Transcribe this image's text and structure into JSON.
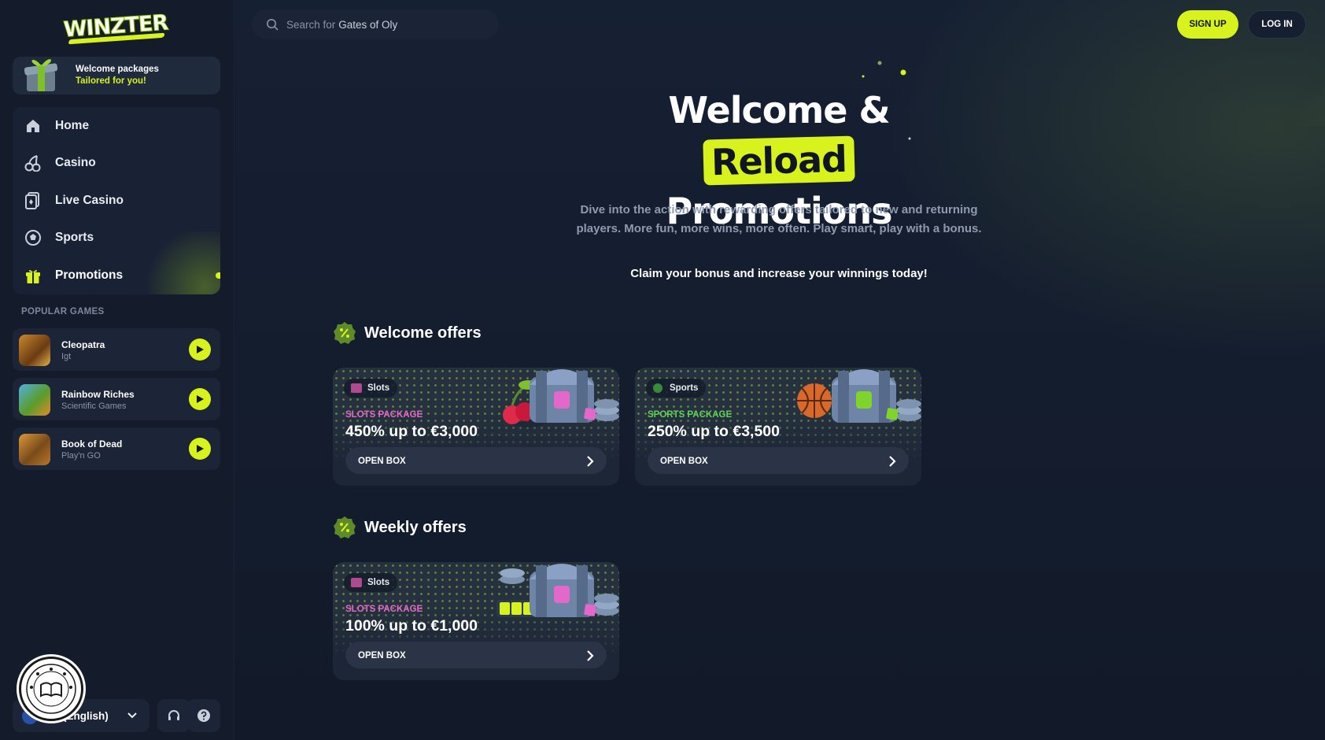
{
  "brand": {
    "logo_text": "WINZTER",
    "accent": "#d7f21c"
  },
  "sidebar": {
    "promo_banner": {
      "line1": "Welcome packages",
      "line2": "Tailored for you!"
    },
    "nav": [
      {
        "label": "Home",
        "icon": "home-icon"
      },
      {
        "label": "Casino",
        "icon": "cherry-icon"
      },
      {
        "label": "Live Casino",
        "icon": "live-cards-icon"
      },
      {
        "label": "Sports",
        "icon": "soccer-ball-icon"
      },
      {
        "label": "Promotions",
        "icon": "gift-icon",
        "active": true
      }
    ],
    "popular_label": "POPULAR GAMES",
    "games": [
      {
        "name": "Cleopatra",
        "provider": "Igt"
      },
      {
        "name": "Rainbow Riches",
        "provider": "Scientific Games"
      },
      {
        "name": "Book of Dead",
        "provider": "Play'n GO"
      }
    ],
    "language": "(English)",
    "seal_text": "BOOK OF BONUS"
  },
  "header": {
    "search_label": "Search for",
    "search_value": "Gates of Oly",
    "signup": "SIGN UP",
    "login": "LOG IN"
  },
  "hero": {
    "title_part1": "Welcome &",
    "title_highlight": "Reload",
    "title_part2": "Promotions",
    "description": "Dive into the action with rewarding offers tailored to new and returning players. More fun, more wins, more often. Play smart, play with a bonus.",
    "claim": "Claim your bonus and increase your winnings today!"
  },
  "sections": {
    "welcome": {
      "title": "Welcome offers",
      "offers": [
        {
          "tag": "Slots",
          "kind": "SLOTS PACKAGE",
          "amount": "450% up to €3,000",
          "button": "OPEN BOX",
          "kind_color": "#e468c9"
        },
        {
          "tag": "Sports",
          "kind": "SPORTS PACKAGE",
          "amount": "250% up to €3,500",
          "button": "OPEN BOX",
          "kind_color": "#5fd15a"
        }
      ]
    },
    "weekly": {
      "title": "Weekly offers",
      "offers": [
        {
          "tag": "Slots",
          "kind": "SLOTS PACKAGE",
          "amount": "100% up to €1,000",
          "button": "OPEN BOX",
          "kind_color": "#e468c9"
        }
      ]
    }
  }
}
